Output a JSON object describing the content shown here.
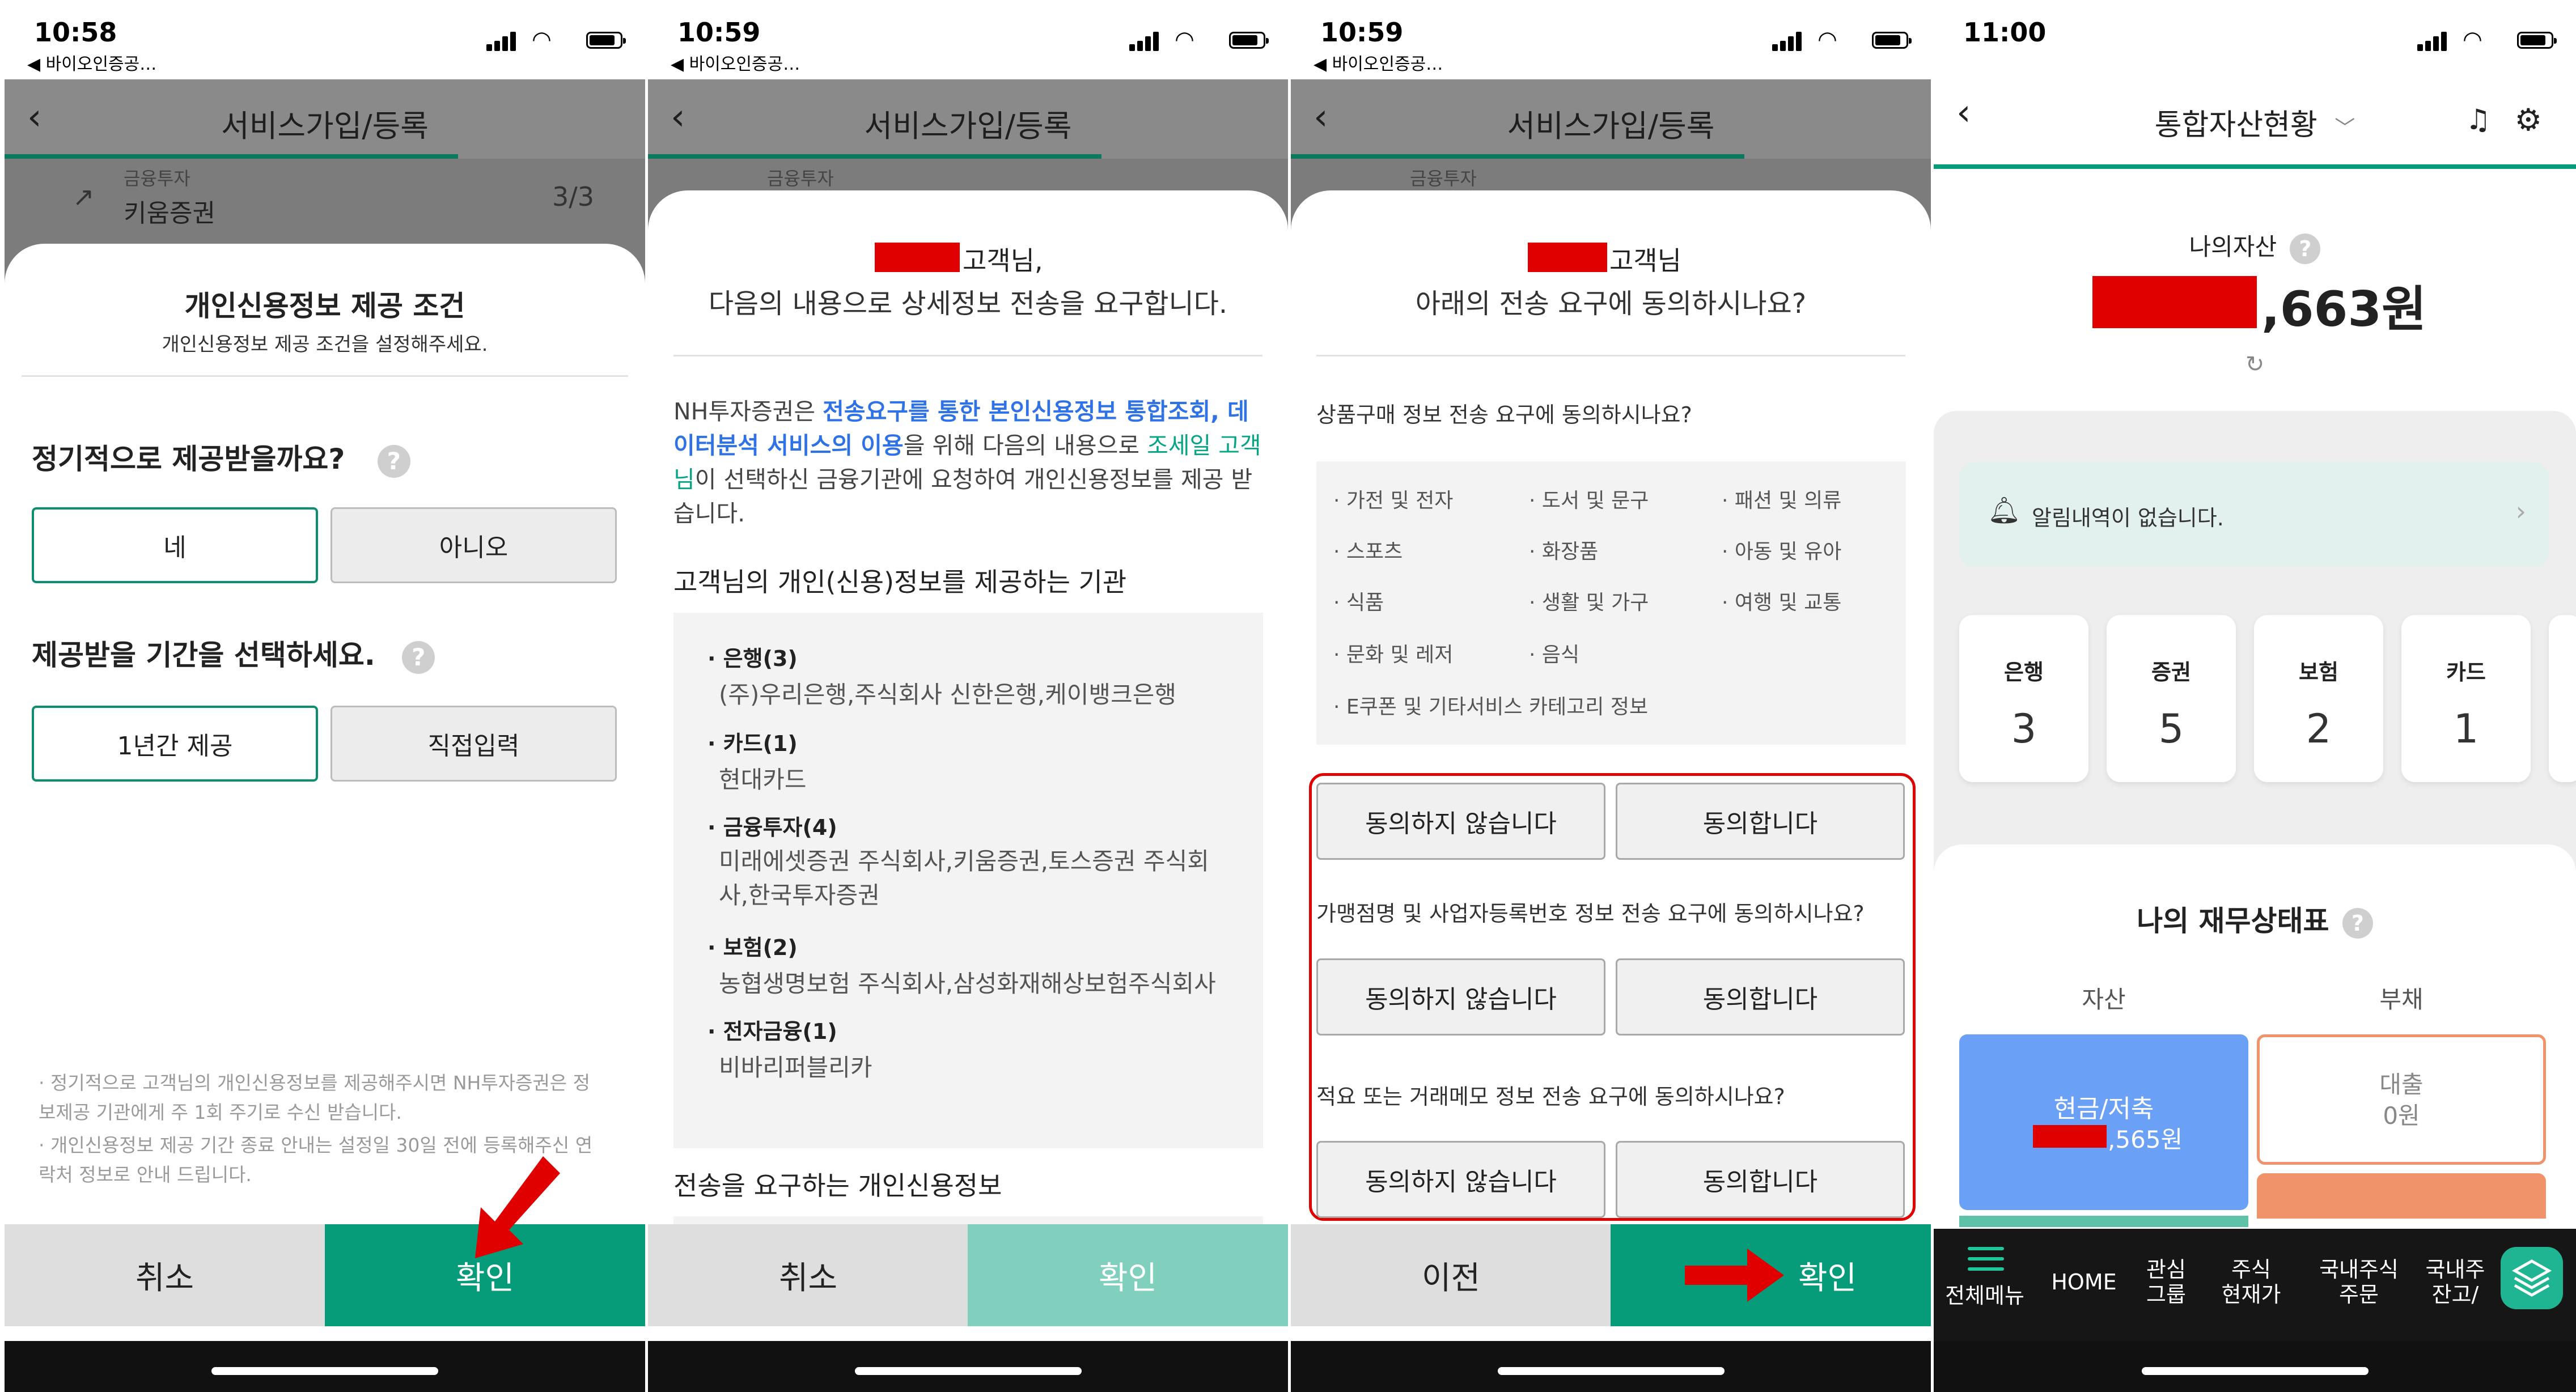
{
  "status": {
    "p1_time": "10:58",
    "p2_time": "10:59",
    "p3_time": "10:59",
    "p4_time": "11:00",
    "back_app": "◀ 바이오인증공…"
  },
  "nav": {
    "title": "서비스가입/등록"
  },
  "behind": {
    "label": "금융투자",
    "value": "키움증권",
    "count": "3/3",
    "count_short": "3/3"
  },
  "p1": {
    "sheet_title": "개인신용정보 제공 조건",
    "sheet_subtitle": "개인신용정보 제공 조건을 설정해주세요.",
    "q1": "정기적으로 제공받을까요?",
    "yes": "네",
    "no": "아니오",
    "q2": "제공받을 기간을 선택하세요.",
    "period1": "1년간 제공",
    "period2": "직접입력",
    "note1": "· 정기적으로 고객님의 개인신용정보를 제공해주시면 NH투자증권은 정보제공 기관에게 주 1회 주기로 수신 받습니다.",
    "note2": "· 개인신용정보 제공 기간 종료 안내는 설정일 30일 전에 등록해주신 연락처 정보로 안내 드립니다.",
    "cancel": "취소",
    "confirm": "확인",
    "help": "?"
  },
  "p2": {
    "greet": "고객님,",
    "headline": "다음의 내용으로 상세정보 전송을 요구합니다.",
    "para_a": "NH투자증권은 ",
    "para_b": "전송요구를 통한 본인신용정보 통합조회, 데이터분석 서비스의 이용",
    "para_c": "을 위해 다음의 내용으로 ",
    "para_d": "조세일 고객님",
    "para_e": "이 선택하신 금융기관에 요청하여 개인신용정보를 제공 받습니다.",
    "section1": "고객님의 개인(신용)정보를 제공하는 기관",
    "orgs": [
      {
        "cat": "은행(3)",
        "names": "(주)우리은행,주식회사 신한은행,케이뱅크은행"
      },
      {
        "cat": "카드(1)",
        "names": "현대카드"
      },
      {
        "cat": "금융투자(4)",
        "names": "미래에셋증권 주식회사,키움증권,토스증권 주식회사,한국투자증권"
      },
      {
        "cat": "보험(2)",
        "names": "농협생명보험 주식회사,삼성화재해상보험주식회사"
      },
      {
        "cat": "전자금융(1)",
        "names": "비바리퍼블리카"
      }
    ],
    "section2": "전송을 요구하는 개인신용정보",
    "cancel": "취소",
    "confirm": "확인"
  },
  "p3": {
    "greet": "고객님",
    "headline": "아래의 전송 요구에 동의하시나요?",
    "q_purchase": "상품구매 정보 전송 요구에 동의하시나요?",
    "categories": [
      "가전 및 전자",
      "도서 및 문구",
      "패션 및 의류",
      "스포츠",
      "화장품",
      "아동 및 유아",
      "식품",
      "생활 및 가구",
      "여행 및 교통",
      "문화 및 레저",
      "음식",
      "",
      "E쿠폰 및 기타서비스 카테고리 정보",
      "",
      ""
    ],
    "disagree": "동의하지 않습니다",
    "agree": "동의합니다",
    "q_merchant": "가맹점명 및 사업자등록번호 정보 전송 요구에 동의하시나요?",
    "q_memo": "적요 또는 거래메모 정보 전송 요구에 동의하시나요?",
    "prev": "이전",
    "confirm": "확인"
  },
  "p4": {
    "title": "통합자산현황",
    "my_assets": "나의자산",
    "amount_suffix": ",663원",
    "refresh": "↻",
    "notice": "알림내역이 없습니다.",
    "tiles": [
      {
        "label": "은행",
        "value": "3"
      },
      {
        "label": "증권",
        "value": "5"
      },
      {
        "label": "보험",
        "value": "2"
      },
      {
        "label": "카드",
        "value": "1"
      }
    ],
    "fin_title": "나의 재무상태표",
    "assets_col": "자산",
    "liab_col": "부채",
    "cash_label": "현금/저축",
    "cash_suffix": ",565원",
    "loan_label": "대출",
    "loan_value": "0원",
    "menu": [
      "전체메뉴",
      "HOME",
      "관심\n그룹",
      "주식\n현재가",
      "국내주식\n주문",
      "국내주\n잔고/"
    ]
  },
  "colors": {
    "green": "#069c7a",
    "green_light": "#80d0bd",
    "blue_link": "#2f72e6",
    "teal_name": "#06a586",
    "red": "#e00000",
    "cash_blue": "#6aa0f5",
    "loan_orange": "#f0936a"
  }
}
